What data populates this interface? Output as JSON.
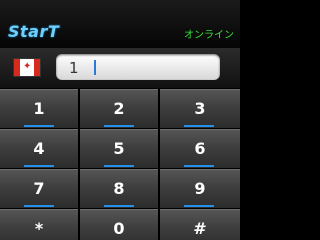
{
  "app": {
    "brand": "StarT",
    "status": "オンライン"
  },
  "country": {
    "flag_icon": "canada-flag-icon"
  },
  "phone": {
    "value": "1"
  },
  "keypad": {
    "keys": [
      "1",
      "2",
      "3",
      "4",
      "5",
      "6",
      "7",
      "8",
      "9",
      "*",
      "0",
      "#"
    ],
    "accent_color": "#2590ea"
  },
  "colors": {
    "brand": "#6ed0ff",
    "status": "#3be23b"
  }
}
